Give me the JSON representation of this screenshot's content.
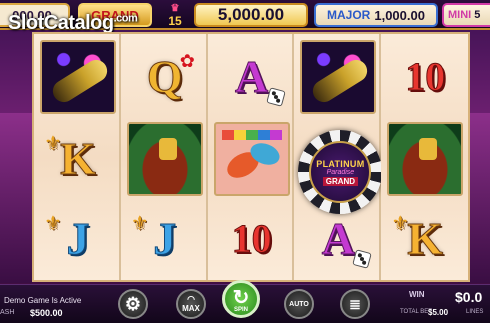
{
  "watermark": {
    "brand": "SlotCatalog",
    "dot": ".com"
  },
  "jackpots": {
    "left_partial": "000.00",
    "grand_label": "GRAND",
    "level": "15",
    "center_value": "5,000.00",
    "major_label": "MAJOR",
    "major_value": "1,000.00",
    "mini_label": "MINI",
    "mini_value": "5"
  },
  "reels": [
    [
      "champagne",
      "K",
      "J"
    ],
    [
      "Q",
      "roulette",
      "J"
    ],
    [
      "A",
      "maracas",
      "10"
    ],
    [
      "champagne",
      "wild",
      "A"
    ],
    [
      "10",
      "roulette",
      "K"
    ]
  ],
  "wild_chip": {
    "line1": "PLATINUM",
    "line2": "Paradise",
    "line3": "GRAND"
  },
  "footer": {
    "demo_message": "Demo Game Is Active",
    "balance_label": "ASH",
    "balance_value": "$500.00",
    "max_label": "MAX",
    "spin_label": "SPIN",
    "auto_label": "AUTO",
    "win_label": "WIN",
    "win_value": "$0.0",
    "total_bet_label": "TOTAL BET",
    "total_bet_value": "$5.00",
    "lines_label": "LINES"
  },
  "colors": {
    "reel_bg": "#f1ddc9",
    "frame_gold": "#c28b2c",
    "spin_green": "#4caf30"
  }
}
